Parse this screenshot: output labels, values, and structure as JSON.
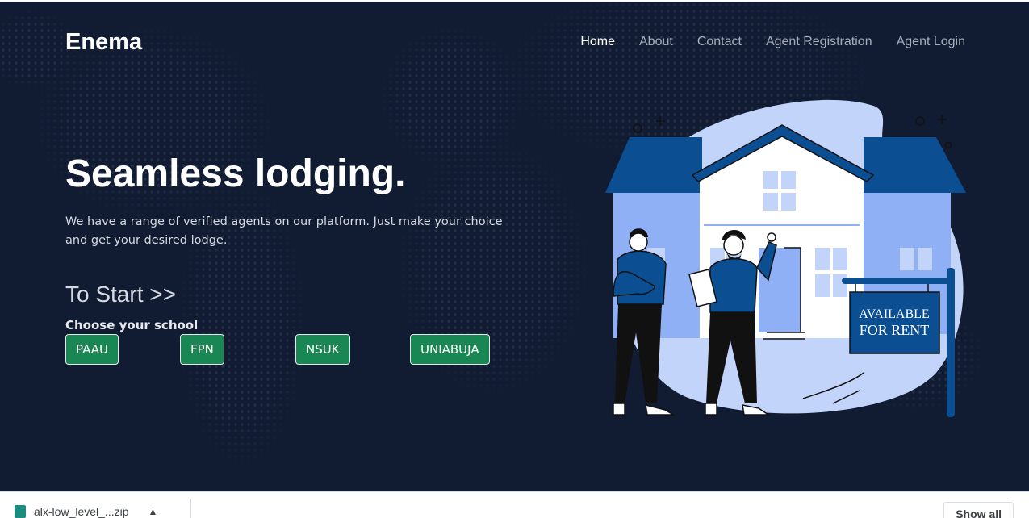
{
  "brand": "Enema",
  "nav": {
    "home": "Home",
    "about": "About",
    "contact": "Contact",
    "agent_registration": "Agent Registration",
    "agent_login": "Agent Login"
  },
  "hero": {
    "title": "Seamless lodging.",
    "subtitle": "We have a range of verified agents on our platform. Just make your choice and get your desired lodge.",
    "to_start": "To Start >>",
    "choose_label": "Choose your school"
  },
  "schools": [
    "PAAU",
    "FPN",
    "NSUK",
    "UNIABUJA"
  ],
  "illustration": {
    "sign_line1": "AVAILABLE",
    "sign_line2": "FOR RENT"
  },
  "download_bar": {
    "file_name": "alx-low_level_...zip",
    "show_all": "Show all"
  },
  "colors": {
    "background": "#111c33",
    "button": "#198754",
    "accent_blue": "#0b4f92",
    "light_blue": "#c3d4fb"
  }
}
